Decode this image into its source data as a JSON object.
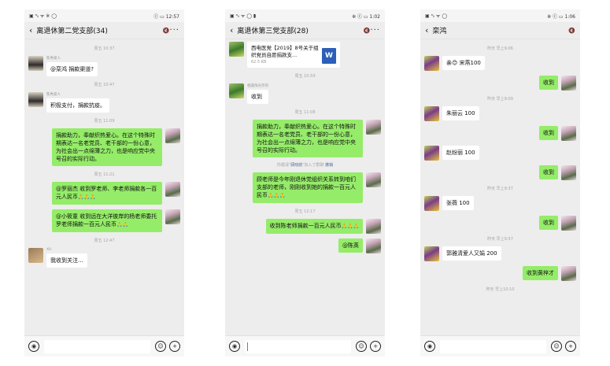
{
  "phone1": {
    "status": {
      "left": "▣ ᵃᵢₗ ᯤ ※ ◯",
      "right": "ⓒ ▭ 12:57"
    },
    "title": "离退休第二党支部(34)",
    "messages": {
      "t1": "周五 10:37",
      "m1_sender": "陈秀爱人",
      "m1_text": "@栾鸿  捐款渠道?",
      "t2": "周五 10:47",
      "m2_sender": "陈秀爱人",
      "m2_text": "积极支付，捐款抗疫。",
      "t3": "周五 11:09",
      "m3_text": "捐款助力，奉献织热爱心。在这个特殊时期表达一名老党员、老干部的一份心意，为社会出一点绵薄之力，也是响应党中央号召的实际行动。",
      "t4": "周五 11:21",
      "m4_text": "@罗丽杰  收到罗老师、李老师捐款各一百元人民币",
      "m4_emoji": "🙏🙏🙏",
      "m5_text": "@小筱童  收到远在大洋彼岸的杨老师委托罗老师捐款一百元人民币",
      "m5_emoji": "🙏🙏",
      "t5": "周五 12:47",
      "m6_sender": "XH",
      "m6_text": "我收到关注..."
    }
  },
  "phone2": {
    "status": {
      "left": "▣ ᵃᵢₗ ᯤ ◯ ▮",
      "right": "✲ ⓒ ▭ 1:02"
    },
    "title": "离退休第三党支部(28)",
    "messages": {
      "file_name": "西电医党【2019】8号关于组织党员自愿捐款支...",
      "file_size": "62.5 KB",
      "file_icon": "W",
      "t1": "周五 10:59",
      "m1_sender": "相逢阳光奈何",
      "m1_text": "收到",
      "t2": "周五 11:08",
      "m2_text": "捐款助力，奉献织热爱心。在这个特殊时期表达一名老党员、老干部的一份心意，为社会出一点绵薄之力，也是响应党中央号召的实际行动。",
      "sys_prefix": "你邀请\"",
      "sys_name": "顾晓航",
      "sys_suffix": "\"加入了群聊",
      "sys_action": "撤销",
      "m3_text": "顾老师是今年刚退休党组织关系转到咱们支部的老师，刚刚收到她的捐款一百元人民币",
      "m3_emoji": "🙏🙏🙏",
      "t3": "周五 12:17",
      "m4_text": "收到陈老师捐款一百元人民币",
      "m4_emoji": "🙏🙏🙏",
      "m5_text": "@陈英"
    }
  },
  "phone3": {
    "status": {
      "left": "▣ ᵃᵢₗ ᯤ ◯",
      "right": "✲ ⓒ ▭ 1:06"
    },
    "title": "栾鸿",
    "messages": {
      "t1": "昨天 早上9:06",
      "m1_text": "亲😊 宋燕100",
      "m2_text": "收到",
      "t2": "昨天 早上9:09",
      "m3_text": "朱丽云 100",
      "m4_text": "收到",
      "m5_text": "赵纷丽 100",
      "m6_text": "收到",
      "t3": "昨天 早上9:37",
      "m7_text": "张薇 100",
      "m8_text": "收到",
      "t4": "昨天 早上9:57",
      "m9_text": "郭雅清爱人又娟 200",
      "m10_text": "收到黄梓才",
      "t5": "昨天 早上10:10"
    }
  },
  "input": {
    "voice_icon": "◉",
    "emoji_icon": "☺",
    "plus_icon": "+"
  }
}
